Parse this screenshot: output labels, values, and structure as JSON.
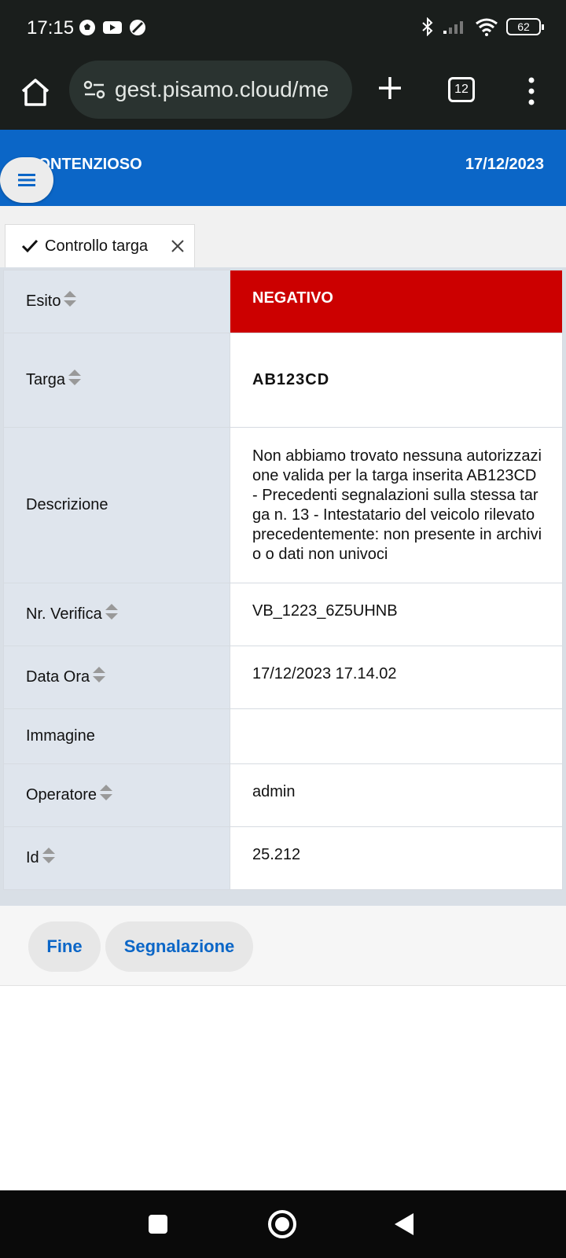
{
  "status_bar": {
    "time": "17:15",
    "battery": "62"
  },
  "browser": {
    "url": "gest.pisamo.cloud/me",
    "tab_count": "12"
  },
  "header": {
    "title": "CONTENZIOSO",
    "date": "17/12/2023"
  },
  "tab": {
    "label": "Controllo targa"
  },
  "rows": [
    {
      "label": "Esito",
      "value": "NEGATIVO"
    },
    {
      "label": "Targa",
      "value": "AB123CD"
    },
    {
      "label": "Descrizione",
      "value": "Non abbiamo trovato nessuna autorizzazione valida per la targa inserita AB123CD - Precedenti segnalazioni sulla stessa targa n. 13 - Intestatario del veicolo rilevato precedentemente: non presente in archivio o dati non univoci"
    },
    {
      "label": "Nr. Verifica",
      "value": "VB_1223_6Z5UHNB"
    },
    {
      "label": "Data Ora",
      "value": "17/12/2023 17.14.02"
    },
    {
      "label": "Immagine",
      "value": ""
    },
    {
      "label": "Operatore",
      "value": "admin"
    },
    {
      "label": "Id",
      "value": "25.212"
    }
  ],
  "buttons": {
    "fine": "Fine",
    "segnalazione": "Segnalazione"
  },
  "colors": {
    "header_blue": "#0b66c7",
    "negative_red": "#cc0000"
  }
}
